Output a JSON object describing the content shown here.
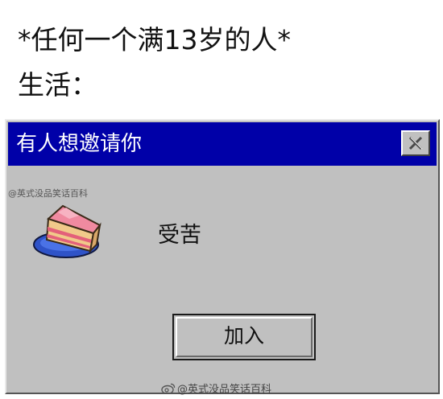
{
  "caption": {
    "line1": "*任何一个满13岁的人*",
    "line2": "生活："
  },
  "dialog": {
    "title": "有人想邀请你",
    "message": "受苦",
    "button_label": "加入",
    "close_icon": "close-icon",
    "image_icon": "cake-slice-icon",
    "titlebar_color": "#0000a8",
    "window_color": "#c0c0c0"
  },
  "watermarks": {
    "top": "@英式没品笑话百科",
    "bottom": "@英式没品笑话百科"
  }
}
